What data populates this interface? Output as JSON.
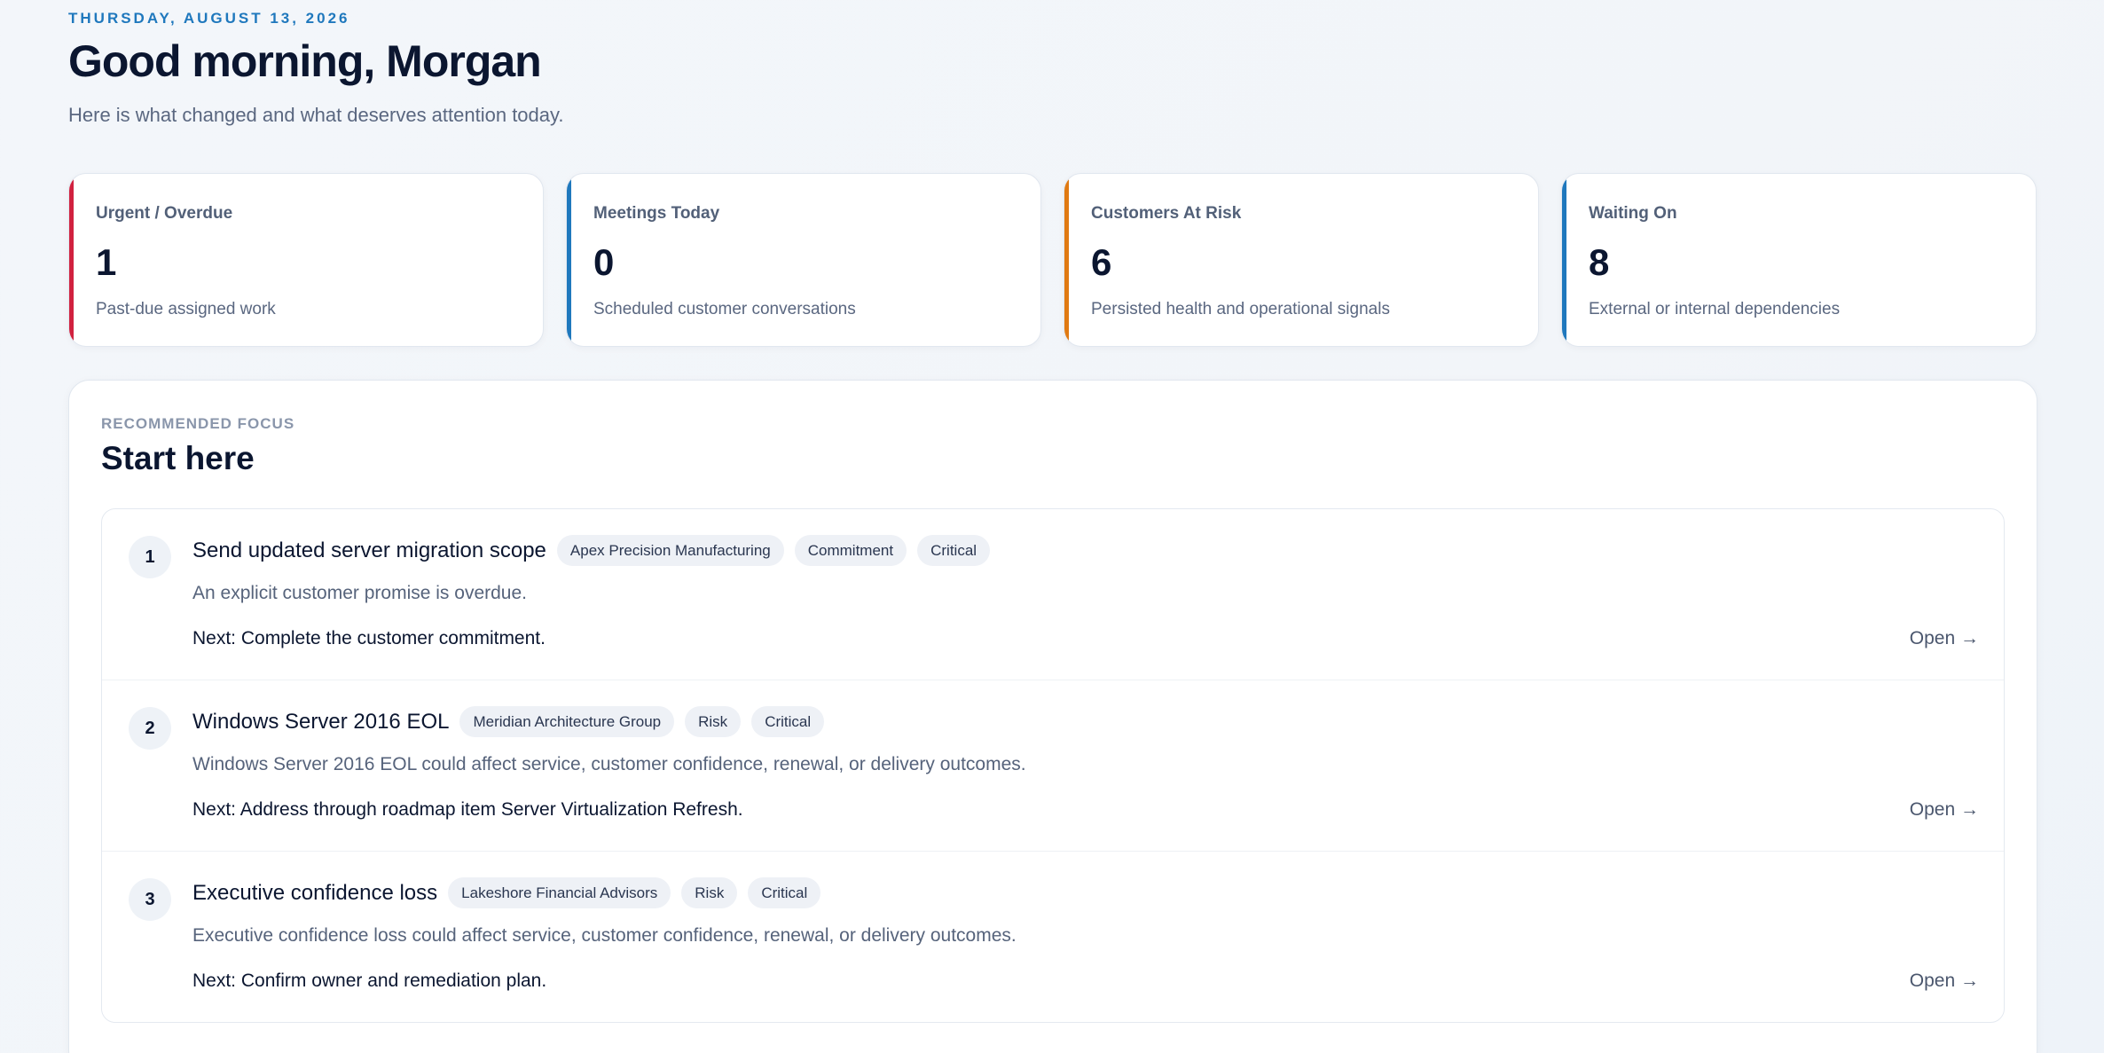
{
  "header": {
    "date": "THURSDAY, AUGUST 13, 2026",
    "greeting": "Good morning, Morgan",
    "subtitle": "Here is what changed and what deserves attention today."
  },
  "stats": [
    {
      "label": "Urgent / Overdue",
      "value": "1",
      "description": "Past-due assigned work",
      "accent": "#d1213f"
    },
    {
      "label": "Meetings Today",
      "value": "0",
      "description": "Scheduled customer conversations",
      "accent": "#1f78bd"
    },
    {
      "label": "Customers At Risk",
      "value": "6",
      "description": "Persisted health and operational signals",
      "accent": "#e07a12"
    },
    {
      "label": "Waiting On",
      "value": "8",
      "description": "External or internal dependencies",
      "accent": "#1f78bd"
    }
  ],
  "focus": {
    "eyebrow": "RECOMMENDED FOCUS",
    "title": "Start here",
    "items": [
      {
        "number": "1",
        "title": "Send updated server migration scope",
        "tags": [
          "Apex Precision Manufacturing",
          "Commitment",
          "Critical"
        ],
        "description": "An explicit customer promise is overdue.",
        "next": "Next: Complete the customer commitment.",
        "action": "Open →"
      },
      {
        "number": "2",
        "title": "Windows Server 2016 EOL",
        "tags": [
          "Meridian Architecture Group",
          "Risk",
          "Critical"
        ],
        "description": "Windows Server 2016 EOL could affect service, customer confidence, renewal, or delivery outcomes.",
        "next": "Next: Address through roadmap item Server Virtualization Refresh.",
        "action": "Open →"
      },
      {
        "number": "3",
        "title": "Executive confidence loss",
        "tags": [
          "Lakeshore Financial Advisors",
          "Risk",
          "Critical"
        ],
        "description": "Executive confidence loss could affect service, customer confidence, renewal, or delivery outcomes.",
        "next": "Next: Confirm owner and remediation plan.",
        "action": "Open →"
      }
    ]
  }
}
